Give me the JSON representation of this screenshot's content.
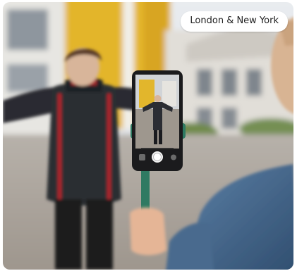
{
  "photo": {
    "subjects": [
      "man-with-outstretched-arms",
      "person-filming-with-phone",
      "phone-selfie-stick"
    ],
    "colors": {
      "sky": "#dfe3e8",
      "wall_yellow": "#e2b62c",
      "house_white": "#e6e4df",
      "jacket_dark": "#2b2d33",
      "jacket_red": "#b4202a",
      "ground": "#a9a29a",
      "filmer_jacket": "#4d6f93",
      "stick_green": "#2f7a62"
    }
  },
  "badge": {
    "label": "London & New York"
  }
}
